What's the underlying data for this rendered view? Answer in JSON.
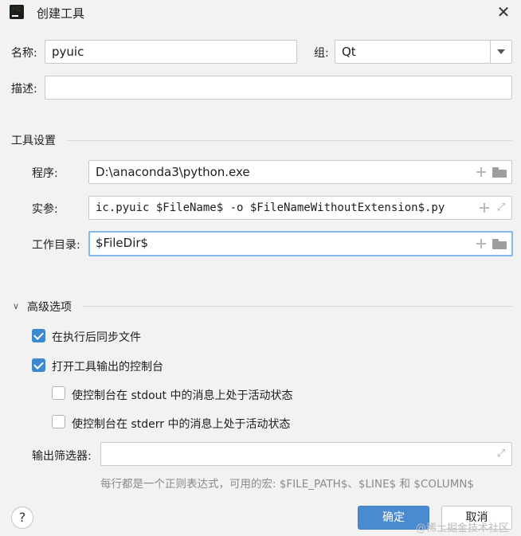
{
  "window": {
    "title": "创建工具",
    "logo_text": "PC"
  },
  "fields": {
    "name_label": "名称:",
    "name_value": "pyuic",
    "group_label": "组:",
    "group_value": "Qt",
    "description_label": "描述:",
    "description_value": ""
  },
  "tool_settings": {
    "section_title": "工具设置",
    "program_label": "程序:",
    "program_value": "D:\\anaconda3\\python.exe",
    "args_label": "实参:",
    "args_value": "ic.pyuic $FileName$ -o $FileNameWithoutExtension$.py",
    "workdir_label": "工作目录:",
    "workdir_value": "$FileDir$"
  },
  "advanced": {
    "section_title": "高级选项",
    "sync_files_label": "在执行后同步文件",
    "sync_files_checked": true,
    "open_console_label": "打开工具输出的控制台",
    "open_console_checked": true,
    "stdout_label": "使控制台在 stdout 中的消息上处于活动状态",
    "stdout_checked": false,
    "stderr_label": "使控制台在 stderr 中的消息上处于活动状态",
    "stderr_checked": false,
    "filter_label": "输出筛选器:",
    "filter_value": "",
    "filter_hint": "每行都是一个正则表达式，可用的宏: $FILE_PATH$、$LINE$ 和 $COLUMN$"
  },
  "buttons": {
    "help": "?",
    "ok": "确定",
    "cancel": "取消"
  },
  "watermark": "@稀土掘金技术社区",
  "icons": [
    "pycharm-logo-icon",
    "close-icon",
    "chevron-down-icon",
    "plus-icon",
    "folder-icon",
    "expand-icon",
    "check-icon",
    "help-icon"
  ],
  "colors": {
    "accent": "#4a8ad0",
    "checkbox": "#3d88cf",
    "focus_border": "#87b8eb",
    "background": "#f2f2f2"
  }
}
